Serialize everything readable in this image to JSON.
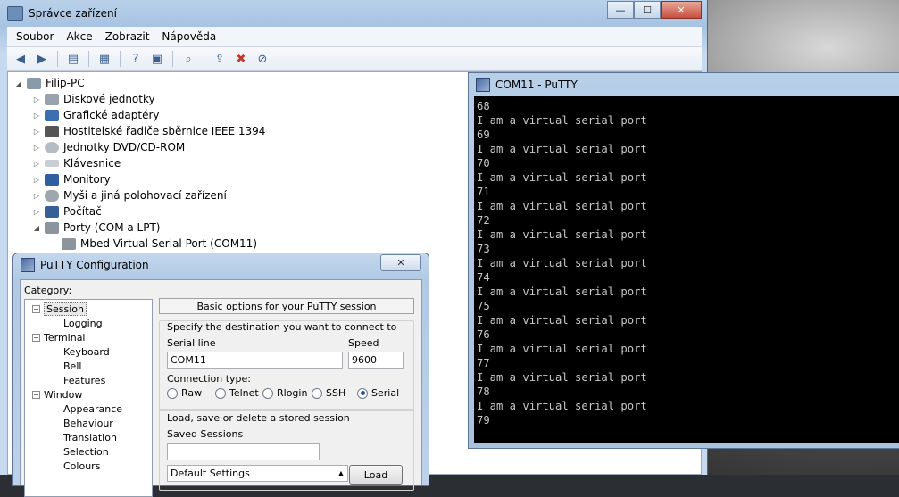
{
  "device_manager": {
    "title": "Správce zařízení",
    "window_controls": [
      "—",
      "☐",
      "✕"
    ],
    "menu": [
      "Soubor",
      "Akce",
      "Zobrazit",
      "Nápověda"
    ],
    "toolbar_icons": [
      "back-arrow-icon",
      "forward-arrow-icon",
      "show-hide-tree-icon",
      "properties-icon",
      "help-icon",
      "view-icon",
      "scan-hardware-icon",
      "update-driver-icon",
      "uninstall-icon",
      "disable-icon"
    ],
    "tree": {
      "root": "Filip-PC",
      "items": [
        "Diskové jednotky",
        "Grafické adaptéry",
        "Hostitelské řadiče sběrnice IEEE 1394",
        "Jednotky DVD/CD-ROM",
        "Klávesnice",
        "Monitory",
        "Myši a jiná polohovací zařízení",
        "Počítač",
        "Porty (COM a LPT)"
      ],
      "port_child": "Mbed Virtual Serial Port (COM11)"
    }
  },
  "terminal": {
    "title": "COM11 - PuTTY",
    "lines": [
      "68",
      "I am a virtual serial port",
      "69",
      "I am a virtual serial port",
      "70",
      "I am a virtual serial port",
      "71",
      "I am a virtual serial port",
      "72",
      "I am a virtual serial port",
      "73",
      "I am a virtual serial port",
      "74",
      "I am a virtual serial port",
      "75",
      "I am a virtual serial port",
      "76",
      "I am a virtual serial port",
      "77",
      "I am a virtual serial port",
      "78",
      "I am a virtual serial port",
      "79"
    ]
  },
  "putty_config": {
    "title": "PuTTY Configuration",
    "close": "✕",
    "category_label": "Category:",
    "categories": {
      "session": "Session",
      "logging": "Logging",
      "terminal": "Terminal",
      "keyboard": "Keyboard",
      "bell": "Bell",
      "features": "Features",
      "window": "Window",
      "appearance": "Appearance",
      "behaviour": "Behaviour",
      "translation": "Translation",
      "selection": "Selection",
      "colours": "Colours"
    },
    "panel_heading": "Basic options for your PuTTY session",
    "destination_label": "Specify the destination you want to connect to",
    "serial_line_label": "Serial line",
    "serial_line_value": "COM11",
    "speed_label": "Speed",
    "speed_value": "9600",
    "connection_type_label": "Connection type:",
    "connection_types": [
      "Raw",
      "Telnet",
      "Rlogin",
      "SSH",
      "Serial"
    ],
    "selected_connection_type": "Serial",
    "load_save_label": "Load, save or delete a stored session",
    "saved_sessions_label": "Saved Sessions",
    "saved_sessions_value": "",
    "session_list_first": "Default Settings",
    "load_button": "Load"
  }
}
